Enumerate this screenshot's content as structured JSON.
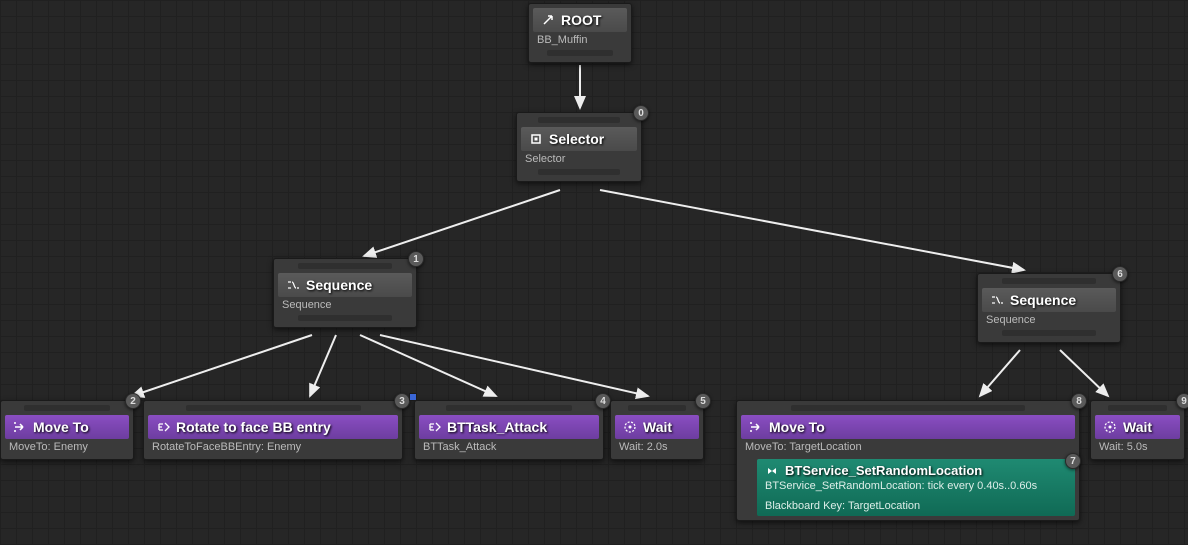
{
  "nodes": {
    "root": {
      "title": "ROOT",
      "subtitle": "BB_Muffin"
    },
    "selector": {
      "title": "Selector",
      "subtitle": "Selector",
      "index": "0"
    },
    "seq1": {
      "title": "Sequence",
      "subtitle": "Sequence",
      "index": "1"
    },
    "seq2": {
      "title": "Sequence",
      "subtitle": "Sequence",
      "index": "6"
    },
    "moveTo1": {
      "title": "Move To",
      "subtitle": "MoveTo: Enemy",
      "index": "2"
    },
    "rotate": {
      "title": "Rotate to face BB entry",
      "subtitle": "RotateToFaceBBEntry: Enemy",
      "index": "3"
    },
    "attack": {
      "title": "BTTask_Attack",
      "subtitle": "BTTask_Attack",
      "index": "4"
    },
    "wait1": {
      "title": "Wait",
      "subtitle": "Wait: 2.0s",
      "index": "5"
    },
    "moveTo2": {
      "title": "Move To",
      "subtitle": "MoveTo: TargetLocation",
      "index": "8",
      "serviceIndex": "7",
      "serviceTitle": "BTService_SetRandomLocation",
      "serviceLine1": "BTService_SetRandomLocation: tick every 0.40s..0.60s",
      "serviceLine2": "Blackboard Key: TargetLocation"
    },
    "wait2": {
      "title": "Wait",
      "subtitle": "Wait: 5.0s",
      "index": "9"
    }
  }
}
